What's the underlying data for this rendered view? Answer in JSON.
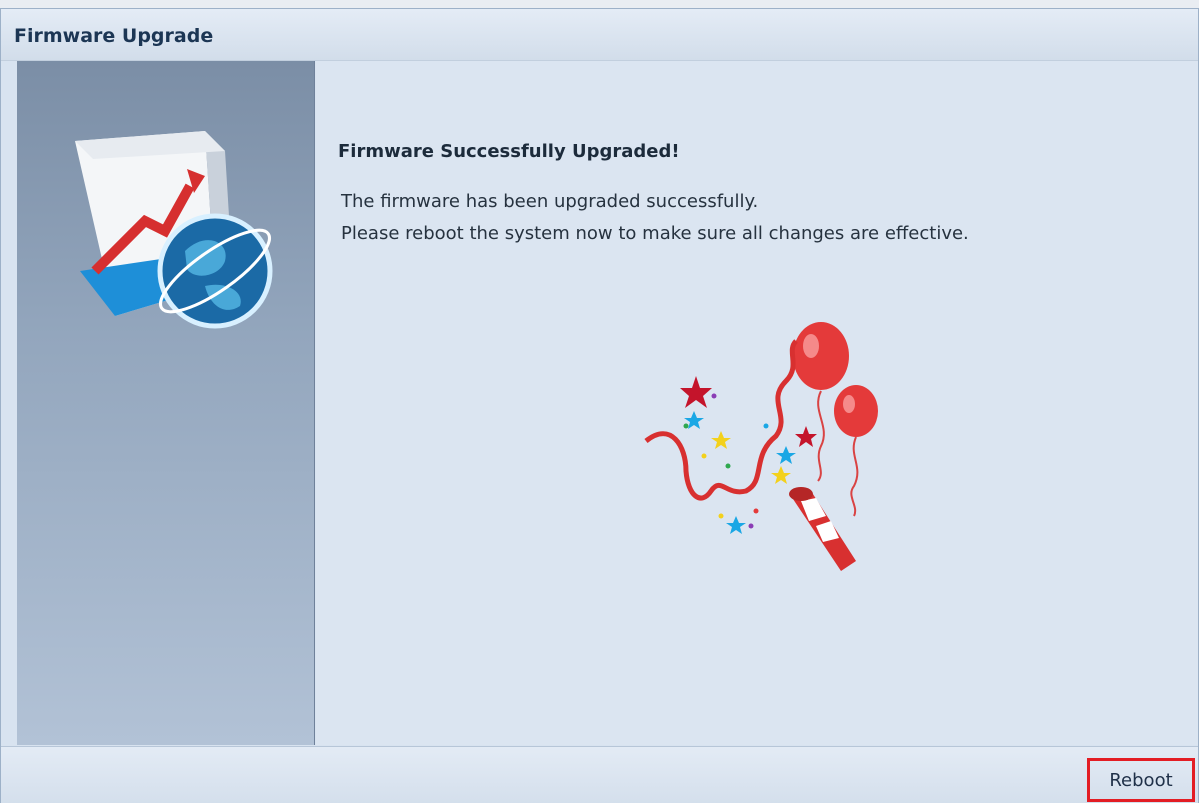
{
  "window": {
    "title": "Firmware Upgrade"
  },
  "content": {
    "heading": "Firmware Successfully Upgraded!",
    "line1": "The firmware has been upgraded successfully.",
    "line2": "Please reboot the system now to make sure all changes are effective."
  },
  "footer": {
    "reboot_label": "Reboot"
  },
  "icons": {
    "side": "firmware-box-globe-icon",
    "celebration": "party-popper-balloons-icon"
  },
  "colors": {
    "highlight_border": "#e31d24",
    "title_text": "#1c3654"
  }
}
